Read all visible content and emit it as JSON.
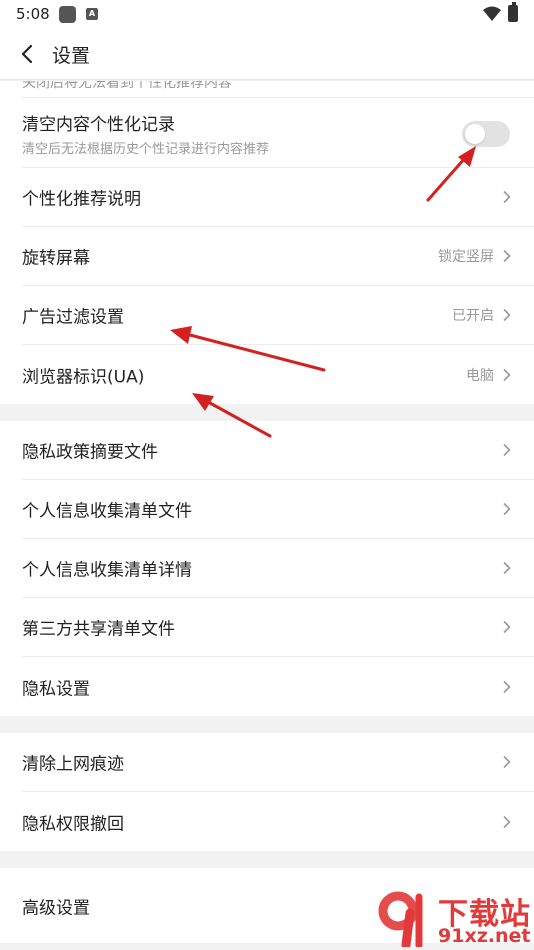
{
  "status_bar": {
    "time": "5:08",
    "notif_letter": "A"
  },
  "app_bar": {
    "title": "设置"
  },
  "rows": {
    "clipped_text": "关闭后将无法看到个性化推荐内容",
    "clear_personal": {
      "label": "清空内容个性化记录",
      "sublabel": "清空后无法根据历史个性记录进行内容推荐",
      "toggle_on": false
    },
    "recommend_desc": {
      "label": "个性化推荐说明"
    },
    "rotate_screen": {
      "label": "旋转屏幕",
      "value": "锁定竖屏"
    },
    "ad_filter": {
      "label": "广告过滤设置",
      "value": "已开启"
    },
    "browser_ua": {
      "label": "浏览器标识(UA)",
      "value": "电脑"
    },
    "privacy_summary": {
      "label": "隐私政策摘要文件"
    },
    "personal_info_file": {
      "label": "个人信息收集清单文件"
    },
    "personal_info_detail": {
      "label": "个人信息收集清单详情"
    },
    "third_party": {
      "label": "第三方共享清单文件"
    },
    "privacy_settings": {
      "label": "隐私设置"
    },
    "clear_traces": {
      "label": "清除上网痕迹"
    },
    "revoke_privacy": {
      "label": "隐私权限撤回"
    },
    "advanced": {
      "label": "高级设置"
    }
  },
  "watermark": {
    "brand_cn": "下载站",
    "brand_url": "91xz.net"
  },
  "colors": {
    "annotation_arrow": "#d42020",
    "watermark": "#e23a3a",
    "toggle_off": "#e2e2e2"
  }
}
